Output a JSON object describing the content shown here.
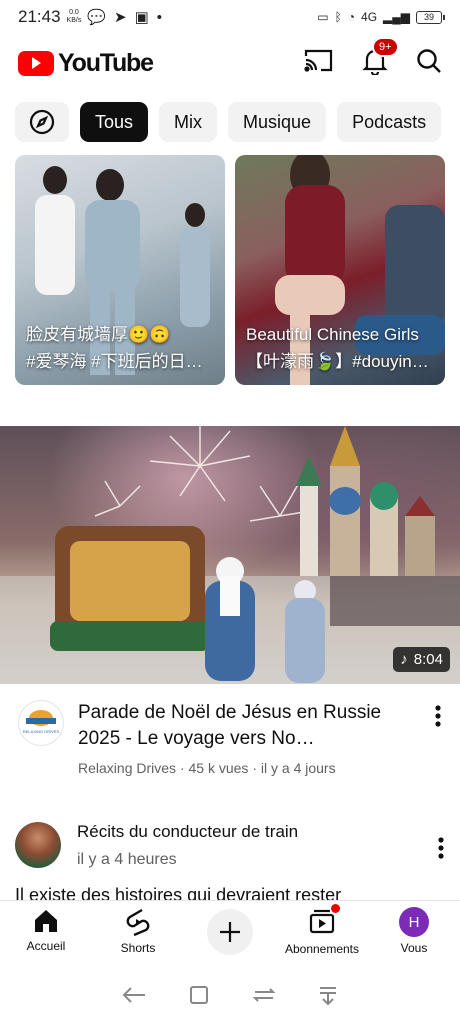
{
  "status": {
    "time": "21:43",
    "net_speed": "0.0",
    "net_unit": "KB/s",
    "battery": "39",
    "signal_label": "4G"
  },
  "header": {
    "logo_text": "YouTube",
    "notif_badge": "9+"
  },
  "chips": [
    {
      "label": ""
    },
    {
      "label": "Tous"
    },
    {
      "label": "Mix"
    },
    {
      "label": "Musique"
    },
    {
      "label": "Podcasts"
    }
  ],
  "shorts": [
    {
      "line1": "脸皮有城墙厚🙂🙃",
      "line2": "#爱琴海 #下班后的日…"
    },
    {
      "line1": "Beautiful Chinese Girls",
      "line2": "【叶濛雨🍃】#douyin…"
    }
  ],
  "video": {
    "duration": "8:04",
    "title": "Parade de Noël de Jésus en Russie 2025 - Le voyage vers No…",
    "channel": "Relaxing Drives",
    "views": "45 k vues",
    "age": "il y a 4 jours",
    "channel_logo_text": "RELAXING DRIVES"
  },
  "post": {
    "author": "Récits du conducteur de train",
    "time": "il y a 4 heures",
    "body": "Il existe des histoires qui devraient rester"
  },
  "nav": [
    {
      "label": "Accueil"
    },
    {
      "label": "Shorts"
    },
    {
      "label": ""
    },
    {
      "label": "Abonnements"
    },
    {
      "label": "Vous",
      "avatar_letter": "H"
    }
  ],
  "colors": {
    "brand": "#ff0000",
    "you_avatar": "#7b2bb8",
    "badge": "#cc0000"
  }
}
